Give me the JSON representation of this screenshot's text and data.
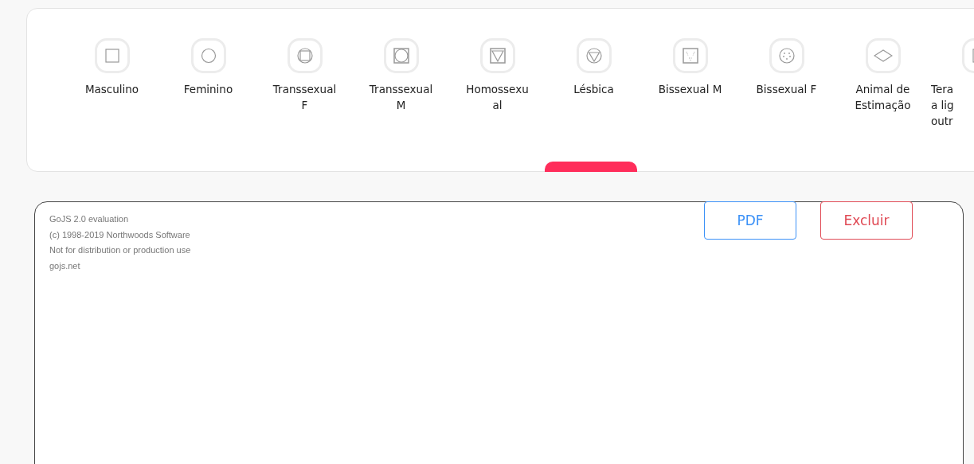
{
  "palette": {
    "items": [
      {
        "lines": [
          "Masculino"
        ],
        "kind": "square"
      },
      {
        "lines": [
          "Feminino"
        ],
        "kind": "circle"
      },
      {
        "lines": [
          "Transsexual",
          "F"
        ],
        "kind": "circle-square"
      },
      {
        "lines": [
          "Transsexual",
          "M"
        ],
        "kind": "square-circle"
      },
      {
        "lines": [
          "Homossexu",
          "al"
        ],
        "kind": "square-triangle"
      },
      {
        "lines": [
          "Lésbica"
        ],
        "kind": "circle-triangle"
      },
      {
        "lines": [
          "Bissexual M"
        ],
        "kind": "square-dots"
      },
      {
        "lines": [
          "Bissexual F"
        ],
        "kind": "circle-dots"
      },
      {
        "lines": [
          "Animal de",
          "Estimação"
        ],
        "kind": "diamond"
      },
      {
        "lines": [
          "Tera",
          "a lig",
          "outr"
        ],
        "kind": "square"
      }
    ]
  },
  "canvas": {
    "notice": [
      "GoJS 2.0 evaluation",
      "(c) 1998-2019 Northwoods Software",
      "Not for distribution or production use",
      "gojs.net"
    ],
    "buttons": [
      {
        "label": "PDF",
        "kind": "primary"
      },
      {
        "label": "Excluir",
        "kind": "danger"
      }
    ]
  }
}
